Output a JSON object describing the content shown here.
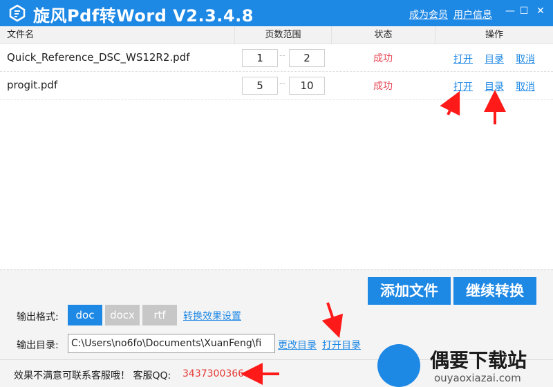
{
  "titlebar": {
    "title": "旋风Pdf转Word V2.3.4.8",
    "member_link": "成为会员",
    "user_info_link": "用户信息",
    "minimize_glyph": "—",
    "maximize_glyph": "☐",
    "close_glyph": "✕"
  },
  "table": {
    "headers": {
      "file": "文件名",
      "range": "页数范围",
      "status": "状态",
      "ops": "操作"
    },
    "rows": [
      {
        "name": "Quick_Reference_DSC_WS12R2.pdf",
        "from": "1",
        "to": "2",
        "status": "成功",
        "open": "打开",
        "dir": "目录",
        "cancel": "取消"
      },
      {
        "name": "progit.pdf",
        "from": "5",
        "to": "10",
        "status": "成功",
        "open": "打开",
        "dir": "目录",
        "cancel": "取消"
      }
    ],
    "range_separator": "--"
  },
  "bottom": {
    "add_file": "添加文件",
    "continue": "继续转换",
    "format_label": "输出格式:",
    "formats": [
      "doc",
      "docx",
      "rtf"
    ],
    "selected_format": "doc",
    "effect_settings": "转换效果设置",
    "dir_label": "输出目录:",
    "dir_value": "C:\\Users\\no6fo\\Documents\\XuanFeng\\fi",
    "change_dir": "更改目录",
    "open_dir": "打开目录"
  },
  "footer": {
    "text": "效果不满意可联系客服哦！ 客服QQ:",
    "qq": "3437300366"
  },
  "watermark": {
    "title": "偶要下载站",
    "sub": "ouyaoxiazai.com"
  },
  "colors": {
    "accent": "#1e88e5",
    "success": "#e54d5b",
    "qq": "#e53935",
    "annotation": "#ff1a1a"
  }
}
